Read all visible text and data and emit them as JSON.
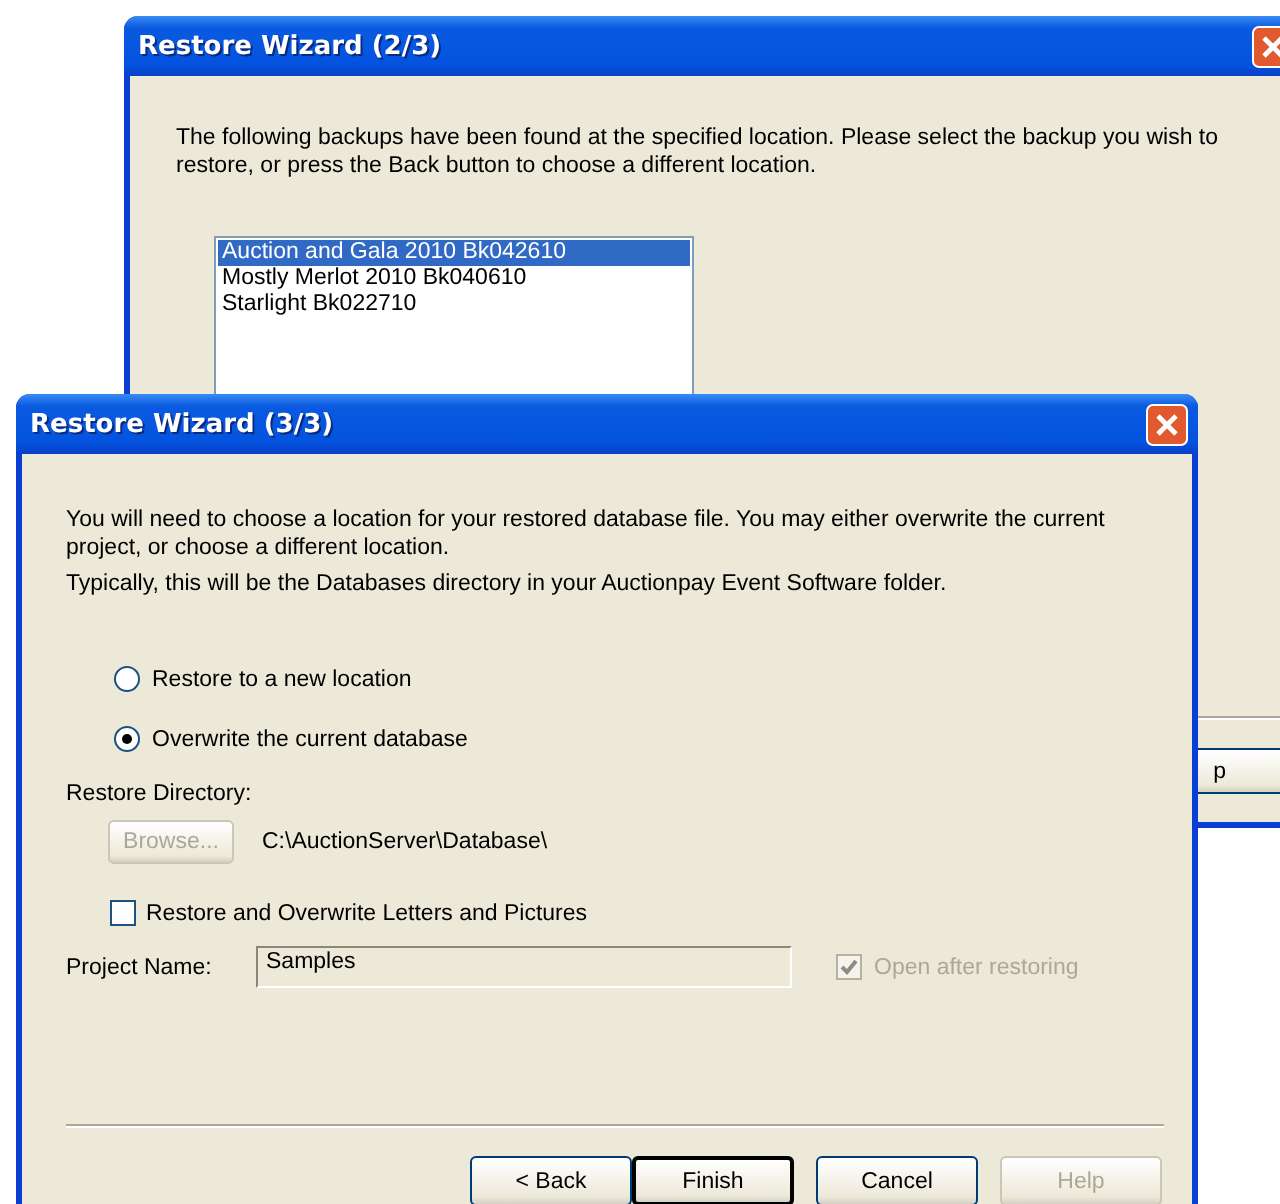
{
  "back_window": {
    "title": "Restore Wizard (2/3)",
    "intro": "The following backups have been found at the specified location. Please select the backup you wish to restore, or press the Back button to choose a different location.",
    "backups": [
      {
        "label": "Auction and Gala 2010 Bk042610",
        "selected": true
      },
      {
        "label": "Mostly Merlot 2010 Bk040610",
        "selected": false
      },
      {
        "label": "Starlight Bk022710",
        "selected": false
      }
    ],
    "buttons": [
      {
        "label": "p",
        "disabled": false
      }
    ]
  },
  "front_window": {
    "title": "Restore Wizard (3/3)",
    "paragraphs": [
      "You will need to choose a location for your restored database file. You may either overwrite the current project, or choose a different location.",
      "Typically, this will be the Databases directory in your Auctionpay Event Software folder."
    ],
    "options": [
      {
        "label": "Restore to a new location",
        "selected": false
      },
      {
        "label": "Overwrite the current database",
        "selected": true
      }
    ],
    "directory_label": "Restore Directory:",
    "browse_button": {
      "label": "Browse...",
      "disabled": true
    },
    "directory_path": "C:\\AuctionServer\\Database\\",
    "letters_checkbox": {
      "label": "Restore and Overwrite Letters and Pictures",
      "checked": false,
      "disabled": false
    },
    "project_name": {
      "label": "Project Name:",
      "value": "Samples"
    },
    "open_checkbox": {
      "label": "Open after restoring",
      "checked": true,
      "disabled": true
    },
    "buttons": [
      {
        "label": "< Back",
        "default": false,
        "disabled": false
      },
      {
        "label": "Finish",
        "default": true,
        "disabled": false
      },
      {
        "label": "Cancel",
        "default": false,
        "disabled": false
      },
      {
        "label": "Help",
        "default": false,
        "disabled": true
      }
    ]
  }
}
